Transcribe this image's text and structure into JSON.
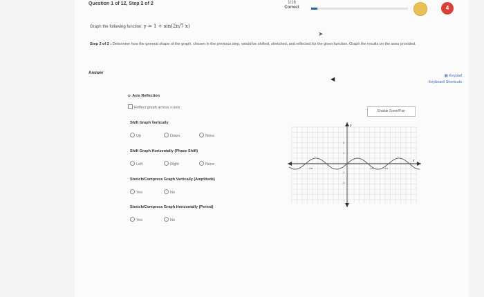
{
  "header": {
    "question_title": "Question 1 of 12, Step 2 of 2",
    "progress_count": "1/16",
    "progress_status": "Correct",
    "progress_fraction": 0.0625,
    "hearts": "4",
    "accent_color": "#2a5db0",
    "heart_color": "#d9403a",
    "coin_color": "#e8c15a"
  },
  "problem": {
    "prompt": "Graph the following function:",
    "equation_lhs": "y = 1 + sin",
    "equation_arg": "(2π/7 x)"
  },
  "step": {
    "label": "Step 2 of 2 :",
    "text": "Determine how the general shape of the graph, chosen in the previous step, would be shifted, stretched, and reflected for the given function. Graph the results on the axes provided."
  },
  "answer": {
    "label": "Answer"
  },
  "tools": {
    "keypad": "Keypad",
    "shortcuts": "Keyboard Shortcuts",
    "zoom_pan": "Enable Zoom/Pan"
  },
  "options": {
    "axis_reflection": {
      "title": "x- Axis Reflection",
      "reflect": "Reflect graph across x-axis"
    },
    "shift_vertical": {
      "title": "Shift Graph Vertically",
      "up": "Up",
      "down": "Down",
      "none": "None"
    },
    "shift_horizontal": {
      "title": "Shift Graph Horizontally (Phase Shift)",
      "left": "Left",
      "right": "Right",
      "none": "None"
    },
    "stretch_amplitude": {
      "title": "Stretch/Compress Graph Vertically (Amplitude)",
      "yes": "Yes",
      "no": "No"
    },
    "stretch_period": {
      "title": "Stretch/Compress Graph Horizontally (Period)",
      "yes": "Yes",
      "no": "No"
    }
  },
  "graph": {
    "x_axis_label": "x",
    "y_axis_label": "y",
    "x_tick_labels": [
      "-2π",
      "2π",
      "4π"
    ],
    "y_tick_labels": [
      "2",
      "1",
      "-1",
      "-2"
    ],
    "curve_color": "#555555",
    "grid_color": "#cccccc"
  }
}
